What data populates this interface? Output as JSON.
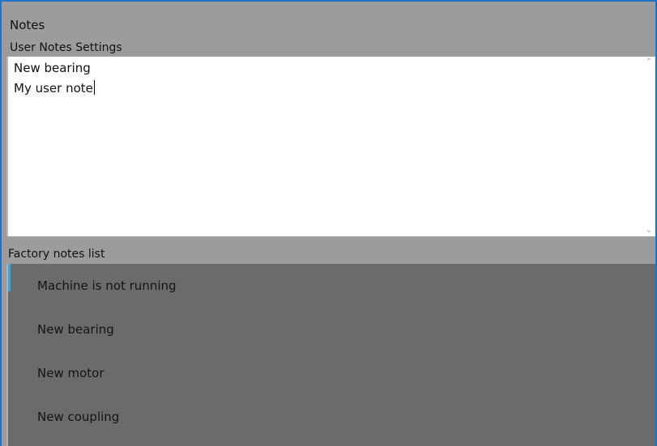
{
  "window": {
    "title": "Notes",
    "section_label": "User Notes Settings"
  },
  "user_notes": {
    "lines": [
      "New bearing",
      "My user note"
    ]
  },
  "factory": {
    "label": "Factory notes list",
    "items": [
      {
        "label": "Machine is not running",
        "selected": true
      },
      {
        "label": "New bearing",
        "selected": false
      },
      {
        "label": "New motor",
        "selected": false
      },
      {
        "label": "New coupling",
        "selected": false
      }
    ]
  },
  "icons": {
    "scroll_up": "chevron-up-icon",
    "scroll_down": "chevron-down-icon"
  },
  "colors": {
    "accent": "#1e73c8",
    "selection": "#3aa6e8",
    "header_bg": "#9c9c9c",
    "list_bg": "#6b6b6b"
  }
}
